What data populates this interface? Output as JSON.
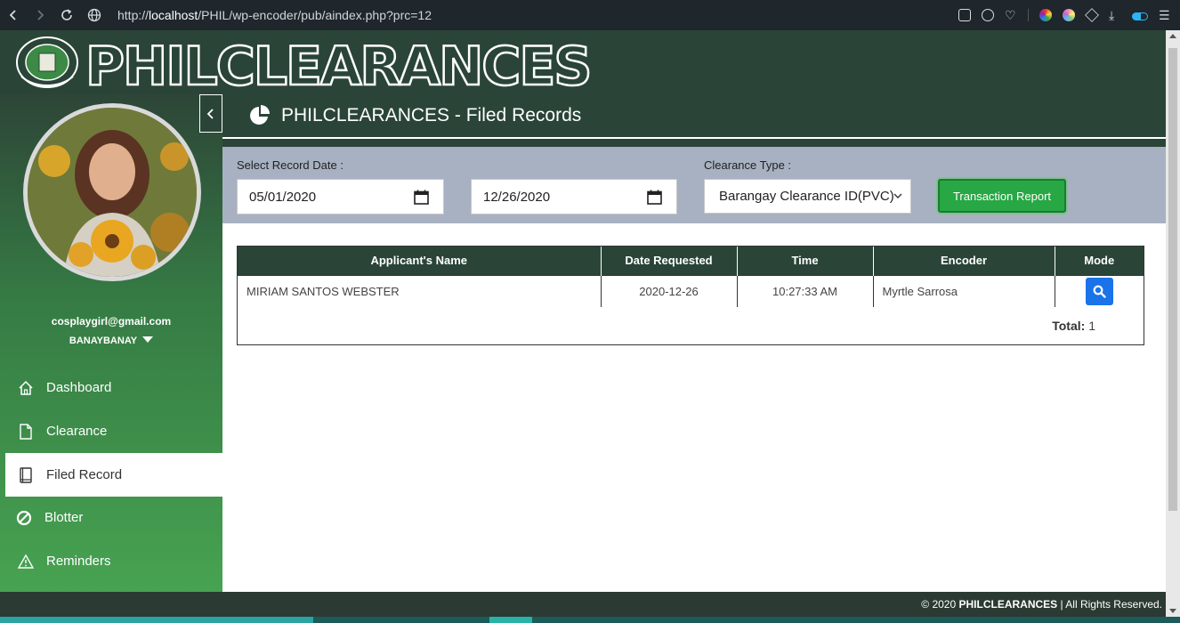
{
  "browser": {
    "url_prefix": "http://",
    "url_host": "localhost",
    "url_path": "/PHIL/wp-encoder/pub/aindex.php?prc=12"
  },
  "header": {
    "brand": "PHILCLEARANCES"
  },
  "sidebar": {
    "email": "cosplaygirl@gmail.com",
    "barangay": "BANAYBANAY",
    "items": [
      {
        "label": "Dashboard",
        "icon": "home-icon"
      },
      {
        "label": "Clearance",
        "icon": "file-icon"
      },
      {
        "label": "Filed Record",
        "icon": "book-icon",
        "active": true
      },
      {
        "label": "Blotter",
        "icon": "ban-icon"
      },
      {
        "label": "Reminders",
        "icon": "warning-icon"
      }
    ]
  },
  "page": {
    "title": "PHILCLEARANCES - Filed Records"
  },
  "filters": {
    "date_label": "Select Record Date :",
    "date_from": "05/01/2020",
    "date_to": "12/26/2020",
    "type_label": "Clearance Type :",
    "type_value": "Barangay Clearance ID(PVC)",
    "report_button": "Transaction Report"
  },
  "table": {
    "headers": [
      "Applicant's Name",
      "Date Requested",
      "Time",
      "Encoder",
      "Mode"
    ],
    "rows": [
      [
        "MIRIAM SANTOS WEBSTER",
        "2020-12-26",
        "10:27:33 AM",
        "Myrtle Sarrosa"
      ]
    ],
    "total_label": "Total:",
    "total_value": "1"
  },
  "footer": {
    "copyright": "© 2020",
    "brand": "PHILCLEARANCES",
    "rights": "| All Rights Reserved."
  },
  "colors": {
    "header_dark": "#2a4537",
    "accent_green": "#28a745",
    "mode_blue": "#1a73e8"
  }
}
